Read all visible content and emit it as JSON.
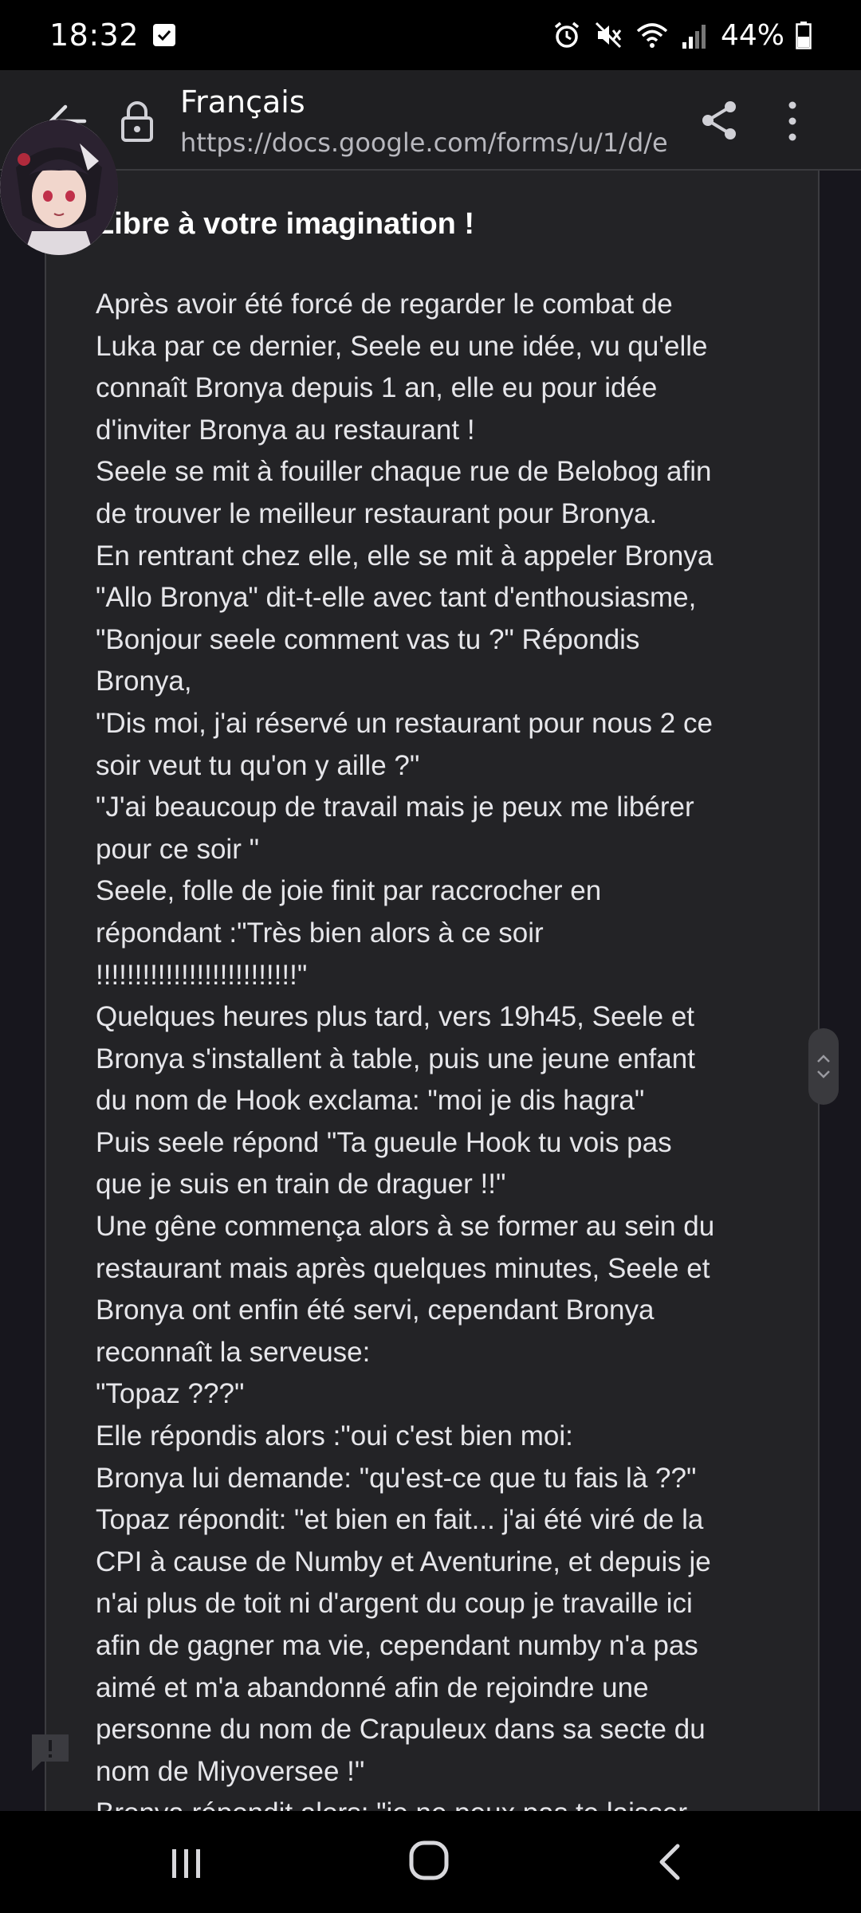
{
  "status": {
    "time": "18:32",
    "battery": "44%"
  },
  "browser": {
    "title": "Français",
    "url": "https://docs.google.com/forms/u/1/d/e"
  },
  "question": {
    "title": "Libre à votre imagination !"
  },
  "answer": {
    "lines": [
      "Après avoir été forcé de regarder le combat de",
      "Luka par ce dernier, Seele eu une idée, vu qu'elle",
      "connaît Bronya depuis 1 an, elle eu pour idée",
      "d'inviter Bronya au restaurant !",
      "Seele se mit à fouiller chaque rue de Belobog afin",
      "de trouver le meilleur restaurant pour Bronya.",
      "En rentrant chez elle, elle se mit à appeler Bronya",
      "\"Allo Bronya\" dit-t-elle avec tant d'enthousiasme,",
      "\"Bonjour seele comment vas tu ?\" Répondis",
      "Bronya,",
      "\"Dis moi, j'ai réservé un restaurant pour nous 2 ce",
      "soir veut tu qu'on y aille ?\"",
      "\"J'ai beaucoup de travail mais je peux me libérer",
      "pour ce soir \"",
      "Seele, folle de joie finit par raccrocher en",
      "répondant :\"Très bien alors à ce soir",
      "!!!!!!!!!!!!!!!!!!!!!!!!!!\"",
      "Quelques heures plus tard, vers 19h45, Seele et",
      "Bronya s'installent à table, puis une jeune enfant",
      "du nom de Hook exclama: \"moi je dis hagra\"",
      "Puis seele répond \"Ta gueule Hook tu vois pas",
      "que je suis en train de draguer !!\"",
      "Une gêne commença alors à se former au sein du",
      "restaurant mais après quelques minutes, Seele et",
      "Bronya ont enfin été servi, cependant Bronya",
      "reconnaît la serveuse:",
      "\"Topaz ???\"",
      "Elle répondis alors :\"oui c'est bien moi:",
      "Bronya lui demande: \"qu'est-ce que tu fais là ??\"",
      "Topaz répondit: \"et bien en fait... j'ai été viré de la",
      "CPI à cause de Numby et Aventurine, et depuis je",
      "n'ai plus de toit ni d'argent du coup je travaille ici",
      "afin de gagner ma vie, cependant numby n'a pas",
      "aimé et m'a abandonné afin de rejoindre une",
      "personne du nom de Crapuleux dans sa secte du",
      "nom de Miyoversee !\"",
      "Bronya répondit alors: \"je ne peux pas te laisser"
    ]
  },
  "icons": {
    "back": "arrow-left-icon",
    "lock": "lock-icon",
    "share": "share-icon",
    "menu": "more-vert-icon",
    "feedback": "feedback-icon"
  }
}
